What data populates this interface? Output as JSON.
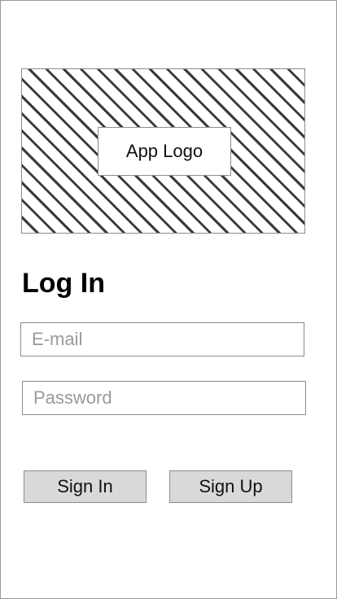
{
  "logo": {
    "label": "App Logo"
  },
  "login": {
    "title": "Log In",
    "email_placeholder": "E-mail",
    "password_placeholder": "Password",
    "sign_in_label": "Sign In",
    "sign_up_label": "Sign Up"
  }
}
